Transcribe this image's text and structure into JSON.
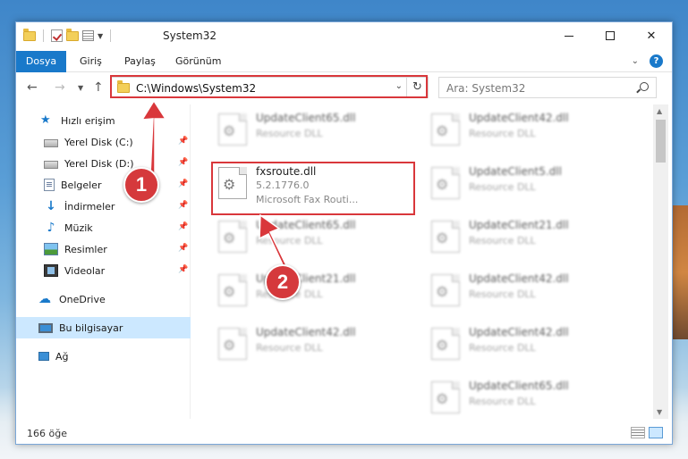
{
  "window": {
    "title": "System32",
    "min_glyph": "",
    "close_glyph": "✕"
  },
  "ribbon": {
    "tabs": [
      "Dosya",
      "Giriş",
      "Paylaş",
      "Görünüm"
    ],
    "help": "?"
  },
  "address": {
    "path": "C:\\Windows\\System32",
    "search_placeholder": "Ara: System32"
  },
  "nav": {
    "quick_access": "Hızlı erişim",
    "items": [
      {
        "label": "Yerel Disk (C:)",
        "icon": "drive-icon",
        "pinned": true
      },
      {
        "label": "Yerel Disk (D:)",
        "icon": "drive-icon",
        "pinned": true
      },
      {
        "label": "Belgeler",
        "icon": "documents-icon",
        "pinned": true
      },
      {
        "label": "İndirmeler",
        "icon": "downloads-icon",
        "pinned": true
      },
      {
        "label": "Müzik",
        "icon": "music-icon",
        "pinned": true
      },
      {
        "label": "Resimler",
        "icon": "pictures-icon",
        "pinned": true
      },
      {
        "label": "Videolar",
        "icon": "videos-icon",
        "pinned": true
      }
    ],
    "onedrive": "OneDrive",
    "this_pc": "Bu bilgisayar",
    "network": "Ağ"
  },
  "files": {
    "left_column": [
      {
        "name": "UpdateClient65.dll",
        "desc": "Resource DLL"
      },
      {
        "name": "fxsroute.dll",
        "desc": "5.2.1776.0",
        "extra": "Microsoft Fax Routi..."
      },
      {
        "name": "UpdateClient65.dll",
        "desc": "Resource DLL"
      },
      {
        "name": "UpdateClient21.dll",
        "desc": "Resource DLL"
      },
      {
        "name": "UpdateClient42.dll",
        "desc": "Resource DLL"
      }
    ],
    "right_column": [
      {
        "name": "UpdateClient42.dll",
        "desc": "Resource DLL"
      },
      {
        "name": "UpdateClient5.dll",
        "desc": "Resource DLL"
      },
      {
        "name": "UpdateClient21.dll",
        "desc": "Resource DLL"
      },
      {
        "name": "UpdateClient42.dll",
        "desc": "Resource DLL"
      },
      {
        "name": "UpdateClient42.dll",
        "desc": "Resource DLL"
      },
      {
        "name": "UpdateClient65.dll",
        "desc": "Resource DLL"
      }
    ]
  },
  "status": {
    "count": "166 öğe"
  },
  "annotations": {
    "step1": "1",
    "step2": "2",
    "color": "#d9373b"
  }
}
